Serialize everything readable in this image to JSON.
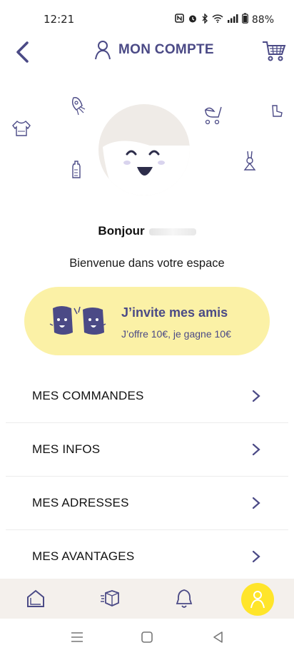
{
  "status_bar": {
    "time": "12:21",
    "battery": "88%",
    "icons": [
      "nfc-icon",
      "alarm-icon",
      "bluetooth-icon",
      "wifi-icon",
      "signal-icon",
      "battery-icon"
    ]
  },
  "header": {
    "title": "MON COMPTE",
    "accent_color": "#4b4a86"
  },
  "greeting": {
    "hello": "Bonjour"
  },
  "welcome_text": "Bienvenue dans votre espace",
  "invite": {
    "title": "J’invite mes amis",
    "subtitle": "J’offre 10€, je gagne 10€",
    "background_color": "#fbf1a6"
  },
  "menu": {
    "items": [
      {
        "label": "MES COMMANDES"
      },
      {
        "label": "MES INFOS"
      },
      {
        "label": "MES ADRESSES"
      },
      {
        "label": "MES AVANTAGES"
      }
    ]
  },
  "bottom_nav": {
    "items": [
      "home-icon",
      "orders-box-icon",
      "notifications-bell-icon",
      "account-user-icon"
    ],
    "active": "account-user-icon",
    "active_color": "#ffe52a"
  }
}
